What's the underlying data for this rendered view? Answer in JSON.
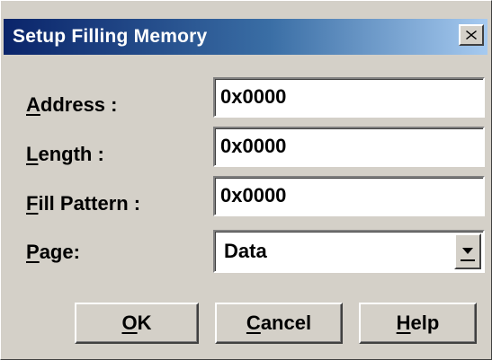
{
  "window": {
    "title": "Setup Filling Memory"
  },
  "title_bar": {
    "close_icon": "close-x",
    "gradient_start": "#0a246a",
    "gradient_end": "#a6caf0"
  },
  "fields": [
    {
      "label": "Address :",
      "value": "0x0000"
    },
    {
      "label": "Length :",
      "value": "0x0000"
    },
    {
      "label": "Fill Pattern :",
      "value": "0x0000"
    }
  ],
  "page": {
    "label": "Page:",
    "selected": "Data",
    "dropdown_icon": "chevron-down"
  },
  "buttons": {
    "ok": "OK",
    "cancel": "Cancel",
    "help": "Help"
  }
}
